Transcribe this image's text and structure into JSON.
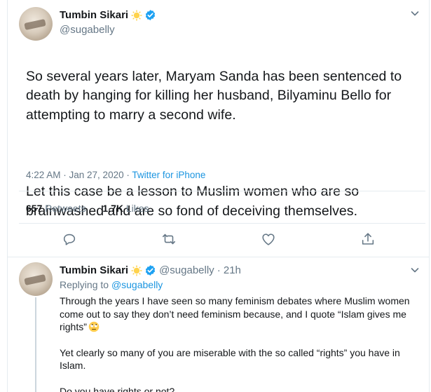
{
  "main_tweet": {
    "author_name": "Tumbin Sikari",
    "author_handle": "@sugabelly",
    "paragraph_1": "So several years later, Maryam Sanda has been sentenced to death by hanging for killing her husband, Bilyaminu Bello for attempting to marry a second wife.",
    "paragraph_2": "Let this case be a lesson to Muslim women who are so brainwashed and are so fond of deceiving themselves.",
    "timestamp": "4:22 AM · Jan 27, 2020 · ",
    "source": "Twitter for iPhone",
    "retweets_count": "657",
    "retweets_label": "Retweets",
    "likes_count": "1.7K",
    "likes_label": "Likes"
  },
  "reply_tweet": {
    "author_name": "Tumbin Sikari",
    "author_handle": "@sugabelly",
    "time_ago": "· 21h",
    "replying_label": "Replying to",
    "replying_to": "@sugabelly",
    "paragraph_1": "Through the years I have seen so many feminism debates where Muslim women come out to say they don’t need feminism because, and I quote “Islam gives me rights”",
    "paragraph_2": "Yet clearly so many of you are miserable with the so called “rights” you have in Islam.",
    "paragraph_3": "Do you have rights or not?"
  },
  "icons": {
    "verified": "verified-badge-icon",
    "status_emoji": "sun-emoji-icon",
    "reply": "reply-icon",
    "retweet": "retweet-icon",
    "like": "heart-icon",
    "share": "share-icon",
    "more": "chevron-down-icon",
    "rolling_eyes": "rolling-eyes-emoji-icon"
  },
  "colors": {
    "accent": "#1b95e0",
    "verified": "#1da1f2",
    "text": "#14171a",
    "muted": "#657786",
    "border": "#e6ecf0"
  }
}
